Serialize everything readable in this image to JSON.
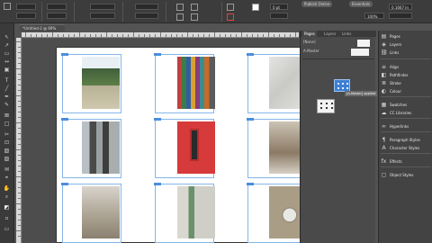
{
  "control_bar": {
    "publish_label": "Publish Online",
    "essentials_label": "Essentials",
    "zoom_value": "0 pt",
    "percent_value": "100%",
    "measure_value": "0.1667 in"
  },
  "document_tab": {
    "label": "*Untitled-2 @ 69%"
  },
  "panel": {
    "tabs": [
      "Pages",
      "Layers",
      "Links"
    ],
    "active_tab": 0,
    "none_label": "[None]",
    "masters_label": "A-Master",
    "drag_tooltip": "[A-Master] applied"
  },
  "dock": {
    "items": [
      {
        "icon": "pages-icon",
        "glyph": "▤",
        "label": "Pages"
      },
      {
        "icon": "layers-icon",
        "glyph": "◈",
        "label": "Layers"
      },
      {
        "icon": "links-icon",
        "glyph": "⛓",
        "label": "Links"
      },
      {
        "icon": "align-icon",
        "glyph": "≡",
        "label": "Align"
      },
      {
        "icon": "pathfinder-icon",
        "glyph": "◧",
        "label": "Pathfinder"
      },
      {
        "icon": "stroke-icon",
        "glyph": "≣",
        "label": "Stroke"
      },
      {
        "icon": "colour-icon",
        "glyph": "◐",
        "label": "Colour"
      },
      {
        "icon": "swatches-icon",
        "glyph": "▦",
        "label": "Swatches"
      },
      {
        "icon": "cc-libraries-icon",
        "glyph": "☁",
        "label": "CC Libraries"
      },
      {
        "icon": "hyperlinks-icon",
        "glyph": "∞",
        "label": "Hyperlinks"
      },
      {
        "icon": "paragraph-styles-icon",
        "glyph": "¶",
        "label": "Paragraph Styles"
      },
      {
        "icon": "character-styles-icon",
        "glyph": "A",
        "label": "Character Styles"
      },
      {
        "icon": "effects-icon",
        "glyph": "fx",
        "label": "Effects"
      },
      {
        "icon": "object-styles-icon",
        "glyph": "▢",
        "label": "Object Styles"
      }
    ]
  },
  "colors": {
    "frame_stroke": "#86b6e8",
    "frame_handle": "#4a8ede",
    "drag_blue": "#3d7fd4",
    "app_bg": "#535353"
  }
}
